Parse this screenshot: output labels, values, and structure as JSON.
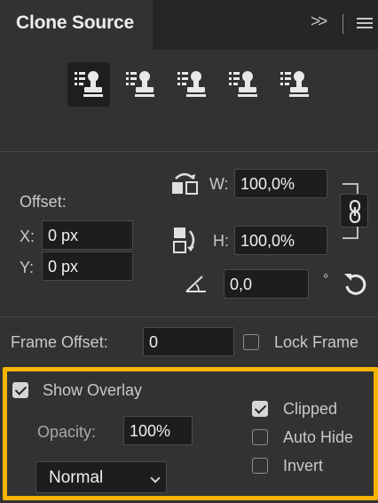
{
  "panel": {
    "title": "Clone Source",
    "collapse_glyph": ">>",
    "menu_icon": "panel-menu-icon"
  },
  "sources": [
    {
      "icon": "clone-stamp-source-icon",
      "active": true
    },
    {
      "icon": "clone-stamp-source-icon",
      "active": false
    },
    {
      "icon": "clone-stamp-source-icon",
      "active": false
    },
    {
      "icon": "clone-stamp-source-icon",
      "active": false
    },
    {
      "icon": "clone-stamp-source-icon",
      "active": false
    }
  ],
  "transform": {
    "offset_label": "Offset:",
    "x_label": "X:",
    "x_value": "0 px",
    "y_label": "Y:",
    "y_value": "0 px",
    "w_label": "W:",
    "w_value": "100,0%",
    "h_label": "H:",
    "h_value": "100,0%",
    "angle_value": "0,0",
    "degree_symbol": "°"
  },
  "frame": {
    "frame_offset_label": "Frame Offset:",
    "frame_offset_value": "0",
    "lock_frame_label": "Lock Frame",
    "lock_frame_checked": false
  },
  "overlay": {
    "show_overlay_label": "Show Overlay",
    "show_overlay_checked": true,
    "opacity_label": "Opacity:",
    "opacity_value": "100%",
    "blend_mode": "Normal",
    "clipped_label": "Clipped",
    "clipped_checked": true,
    "auto_hide_label": "Auto Hide",
    "auto_hide_checked": false,
    "invert_label": "Invert",
    "invert_checked": false
  },
  "colors": {
    "panel_bg": "#323232",
    "field_bg": "#1d1d1d",
    "highlight": "#f5b400"
  }
}
